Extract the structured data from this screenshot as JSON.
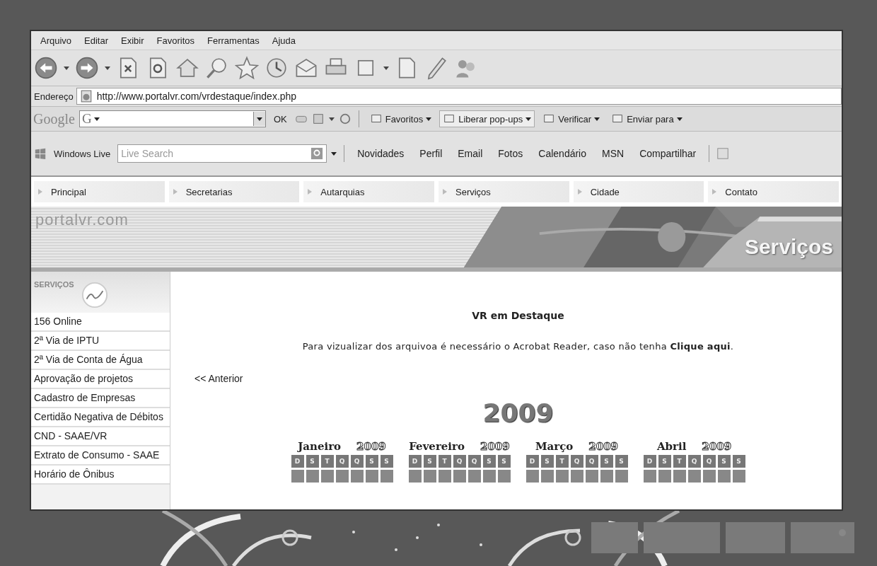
{
  "menu_bar": [
    "Arquivo",
    "Editar",
    "Exibir",
    "Favoritos",
    "Ferramentas",
    "Ajuda"
  ],
  "address_bar": {
    "label": "Endereço",
    "url": "http://www.portalvr.com/vrdestaque/index.php"
  },
  "google_toolbar": {
    "logo": "Google",
    "engine": "G",
    "go": "OK",
    "items": [
      "Favoritos",
      "Liberar pop-ups",
      "Verificar",
      "Enviar para"
    ]
  },
  "live_toolbar": {
    "label": "Windows Live",
    "placeholder": "Live Search",
    "links": [
      "Novidades",
      "Perfil",
      "Email",
      "Fotos",
      "Calendário",
      "MSN",
      "Compartilhar"
    ]
  },
  "site_nav": [
    "Principal",
    "Secretarias",
    "Autarquias",
    "Serviços",
    "Cidade",
    "Contato"
  ],
  "site_header": {
    "logo": "portalvr.com",
    "section": "Serviços"
  },
  "sidebar": {
    "title": "SERVIÇOS",
    "items": [
      "156 Online",
      "2ª Via de IPTU",
      "2ª Via de Conta de Água",
      "Aprovação de projetos",
      "Cadastro de Empresas",
      "Certidão Negativa de Débitos",
      "CND - SAAE/VR",
      "Extrato de Consumo - SAAE",
      "Horário de Ônibus"
    ]
  },
  "content": {
    "title": "VR em Destaque",
    "notice": "Para vizualizar dos arquivoa é necessário o Acrobat Reader, caso não tenha",
    "notice_link": "Clique aqui",
    "notice_end": ".",
    "previous": "<< Anterior",
    "year": "2009",
    "months": [
      {
        "name": "Janeiro",
        "year": "2009",
        "weekdays": [
          "D",
          "S",
          "T",
          "Q",
          "Q",
          "S",
          "S"
        ]
      },
      {
        "name": "Fevereiro",
        "year": "2009",
        "weekdays": [
          "D",
          "S",
          "T",
          "Q",
          "Q",
          "S",
          "S"
        ]
      },
      {
        "name": "Março",
        "year": "2009",
        "weekdays": [
          "D",
          "S",
          "T",
          "Q",
          "Q",
          "S",
          "S"
        ]
      },
      {
        "name": "Abril",
        "year": "2009",
        "weekdays": [
          "D",
          "S",
          "T",
          "Q",
          "Q",
          "S",
          "S"
        ]
      }
    ]
  }
}
